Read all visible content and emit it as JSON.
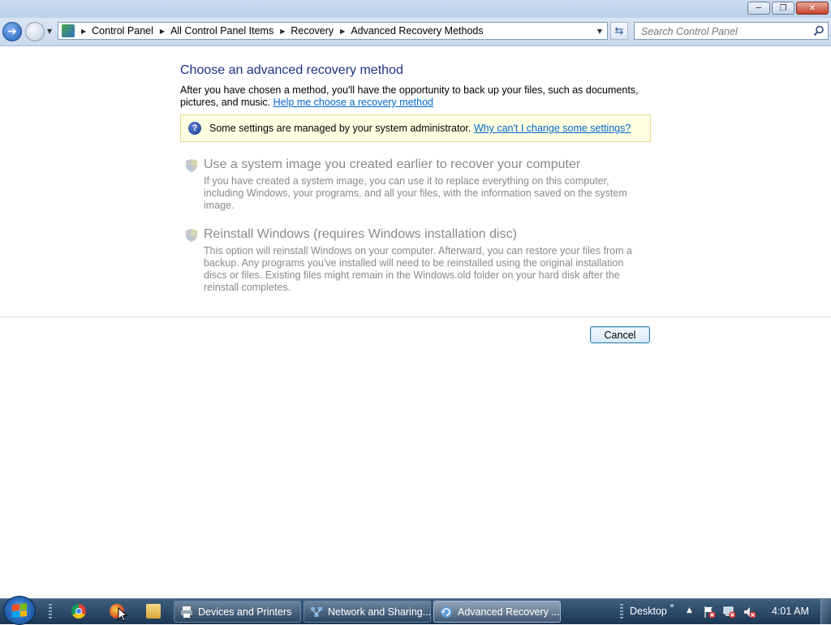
{
  "window": {
    "minimize_icon": "minimize-icon",
    "maximize_icon": "restore-icon",
    "close_icon": "close-icon"
  },
  "navigation": {
    "back_icon": "back-arrow-icon",
    "forward_icon": "forward-arrow-icon",
    "breadcrumbs": [
      "Control Panel",
      "All Control Panel Items",
      "Recovery",
      "Advanced Recovery Methods"
    ],
    "search_placeholder": "Search Control Panel"
  },
  "page": {
    "heading": "Choose an advanced recovery method",
    "intro_text": "After you have chosen a method, you'll have the opportunity to back up your files, such as documents, pictures, and music.",
    "help_link": "Help me choose a recovery method",
    "info_text": "Some settings are managed by your system administrator.",
    "info_link": "Why can't I change some settings?",
    "options": [
      {
        "title": "Use a system image you created earlier to recover your computer",
        "description": "If you have created a system image, you can use it to replace everything on this computer, including Windows, your programs, and all your files, with the information saved on the system image.",
        "icon": "shield-icon"
      },
      {
        "title": "Reinstall Windows (requires Windows installation disc)",
        "description": "This option will reinstall Windows on your computer. Afterward, you can restore your files from a backup. Any programs you've installed will need to be reinstalled using the original installation discs or files. Existing files might remain in the Windows.old folder on your hard disk after the reinstall completes.",
        "icon": "shield-icon"
      }
    ],
    "cancel_label": "Cancel"
  },
  "taskbar": {
    "buttons": [
      {
        "label": "Devices and Printers",
        "icon": "printer-icon"
      },
      {
        "label": "Network and Sharing...",
        "icon": "network-icon"
      },
      {
        "label": "Advanced Recovery ...",
        "icon": "recovery-icon",
        "active": true
      }
    ],
    "desktop_label": "Desktop",
    "clock": "4:01 AM"
  },
  "colors": {
    "heading": "#1e3287",
    "link": "#0066cc",
    "disabled_text": "#8a8a8a",
    "info_background": "#ffffe1"
  }
}
